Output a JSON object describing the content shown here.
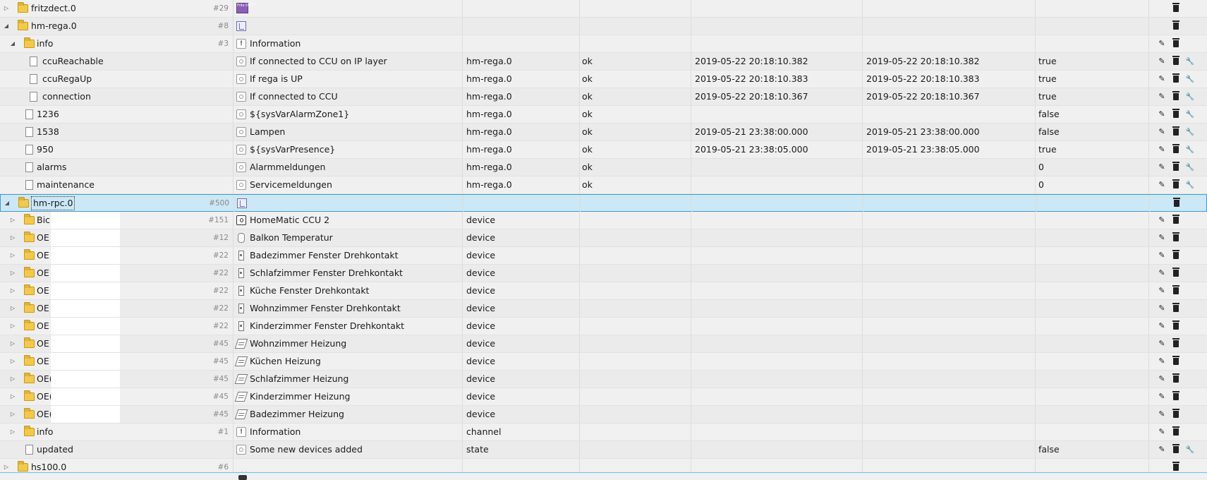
{
  "rows": [
    {
      "level": 0,
      "type": "folder",
      "expander": "collapsed",
      "id": "fritzdect.0",
      "count": "#29",
      "icon": "fritz",
      "icon_text": "Fritz DECT",
      "name": "",
      "role": "",
      "quality": "",
      "ts": "",
      "lc": "",
      "value": "",
      "actions": [
        "delete"
      ]
    },
    {
      "level": 0,
      "type": "folder",
      "expander": "expanded",
      "id": "hm-rega.0",
      "count": "#8",
      "icon": "rega",
      "name": "",
      "role": "",
      "quality": "",
      "ts": "",
      "lc": "",
      "value": "",
      "actions": [
        "delete"
      ]
    },
    {
      "level": 1,
      "type": "folder",
      "expander": "expanded",
      "id": "info",
      "count": "#3",
      "icon": "info",
      "name": "Information",
      "role": "",
      "quality": "",
      "ts": "",
      "lc": "",
      "value": "",
      "actions": [
        "edit",
        "delete"
      ]
    },
    {
      "level": 2,
      "type": "file",
      "expander": "",
      "id": "ccuReachable",
      "count": "",
      "icon": "state",
      "name": "If connected to CCU on IP layer",
      "role": "hm-rega.0",
      "quality": "ok",
      "ts": "2019-05-22 20:18:10.382",
      "lc": "2019-05-22 20:18:10.382",
      "value": "true",
      "actions": [
        "edit",
        "delete",
        "config"
      ]
    },
    {
      "level": 2,
      "type": "file",
      "expander": "",
      "id": "ccuRegaUp",
      "count": "",
      "icon": "state",
      "name": "If rega is UP",
      "role": "hm-rega.0",
      "quality": "ok",
      "ts": "2019-05-22 20:18:10.383",
      "lc": "2019-05-22 20:18:10.383",
      "value": "true",
      "actions": [
        "edit",
        "delete",
        "config"
      ]
    },
    {
      "level": 2,
      "type": "file",
      "expander": "",
      "id": "connection",
      "count": "",
      "icon": "state",
      "name": "If connected to CCU",
      "role": "hm-rega.0",
      "quality": "ok",
      "ts": "2019-05-22 20:18:10.367",
      "lc": "2019-05-22 20:18:10.367",
      "value": "true",
      "actions": [
        "edit",
        "delete",
        "config"
      ]
    },
    {
      "level": 1,
      "type": "file",
      "expander": "",
      "id": "1236",
      "count": "",
      "icon": "state",
      "name": "${sysVarAlarmZone1}",
      "role": "hm-rega.0",
      "quality": "ok",
      "ts": "",
      "lc": "",
      "value": "false",
      "actions": [
        "edit",
        "delete",
        "config"
      ]
    },
    {
      "level": 1,
      "type": "file",
      "expander": "",
      "id": "1538",
      "count": "",
      "icon": "state",
      "name": "Lampen",
      "role": "hm-rega.0",
      "quality": "ok",
      "ts": "2019-05-21 23:38:00.000",
      "lc": "2019-05-21 23:38:00.000",
      "value": "false",
      "actions": [
        "edit",
        "delete",
        "config"
      ]
    },
    {
      "level": 1,
      "type": "file",
      "expander": "",
      "id": "950",
      "count": "",
      "icon": "state",
      "name": "${sysVarPresence}",
      "role": "hm-rega.0",
      "quality": "ok",
      "ts": "2019-05-21 23:38:05.000",
      "lc": "2019-05-21 23:38:05.000",
      "value": "true",
      "actions": [
        "edit",
        "delete",
        "config"
      ]
    },
    {
      "level": 1,
      "type": "file",
      "expander": "",
      "id": "alarms",
      "count": "",
      "icon": "state",
      "name": "Alarmmeldungen",
      "role": "hm-rega.0",
      "quality": "ok",
      "ts": "",
      "lc": "",
      "value": "0",
      "actions": [
        "edit",
        "delete",
        "config"
      ]
    },
    {
      "level": 1,
      "type": "file",
      "expander": "",
      "id": "maintenance",
      "count": "",
      "icon": "state",
      "name": "Servicemeldungen",
      "role": "hm-rega.0",
      "quality": "ok",
      "ts": "",
      "lc": "",
      "value": "0",
      "actions": [
        "edit",
        "delete",
        "config"
      ]
    },
    {
      "level": 0,
      "type": "folder",
      "expander": "expanded",
      "id": "hm-rpc.0",
      "count": "#500",
      "icon": "rega",
      "name": "",
      "role": "",
      "quality": "",
      "ts": "",
      "lc": "",
      "value": "",
      "actions": [
        "delete"
      ],
      "selected": true
    },
    {
      "level": 1,
      "type": "folder",
      "expander": "collapsed",
      "id": "Bic",
      "count": "#151",
      "icon": "device",
      "name": "HomeMatic CCU 2",
      "role": "device",
      "quality": "",
      "ts": "",
      "lc": "",
      "value": "",
      "actions": [
        "edit",
        "delete"
      ],
      "masked": true
    },
    {
      "level": 1,
      "type": "folder",
      "expander": "collapsed",
      "id": "OE",
      "count": "#12",
      "icon": "sensor",
      "name": "Balkon Temperatur",
      "role": "device",
      "quality": "",
      "ts": "",
      "lc": "",
      "value": "",
      "actions": [
        "edit",
        "delete"
      ],
      "masked": true
    },
    {
      "level": 1,
      "type": "folder",
      "expander": "collapsed",
      "id": "OE",
      "count": "#22",
      "icon": "contact",
      "name": "Badezimmer Fenster Drehkontakt",
      "role": "device",
      "quality": "",
      "ts": "",
      "lc": "",
      "value": "",
      "actions": [
        "edit",
        "delete"
      ],
      "masked": true
    },
    {
      "level": 1,
      "type": "folder",
      "expander": "collapsed",
      "id": "OE",
      "count": "#22",
      "icon": "contact",
      "name": "Schlafzimmer Fenster Drehkontakt",
      "role": "device",
      "quality": "",
      "ts": "",
      "lc": "",
      "value": "",
      "actions": [
        "edit",
        "delete"
      ],
      "masked": true
    },
    {
      "level": 1,
      "type": "folder",
      "expander": "collapsed",
      "id": "OE",
      "count": "#22",
      "icon": "contact",
      "name": "Küche Fenster Drehkontakt",
      "role": "device",
      "quality": "",
      "ts": "",
      "lc": "",
      "value": "",
      "actions": [
        "edit",
        "delete"
      ],
      "masked": true
    },
    {
      "level": 1,
      "type": "folder",
      "expander": "collapsed",
      "id": "OE",
      "count": "#22",
      "icon": "contact",
      "name": "Wohnzimmer Fenster Drehkontakt",
      "role": "device",
      "quality": "",
      "ts": "",
      "lc": "",
      "value": "",
      "actions": [
        "edit",
        "delete"
      ],
      "masked": true
    },
    {
      "level": 1,
      "type": "folder",
      "expander": "collapsed",
      "id": "OE",
      "count": "#22",
      "icon": "contact",
      "name": "Kinderzimmer Fenster Drehkontakt",
      "role": "device",
      "quality": "",
      "ts": "",
      "lc": "",
      "value": "",
      "actions": [
        "edit",
        "delete"
      ],
      "masked": true
    },
    {
      "level": 1,
      "type": "folder",
      "expander": "collapsed",
      "id": "OE",
      "count": "#45",
      "icon": "heat",
      "name": "Wohnzimmer Heizung",
      "role": "device",
      "quality": "",
      "ts": "",
      "lc": "",
      "value": "",
      "actions": [
        "edit",
        "delete"
      ],
      "masked": true
    },
    {
      "level": 1,
      "type": "folder",
      "expander": "collapsed",
      "id": "OE",
      "count": "#45",
      "icon": "heat",
      "name": "Küchen Heizung",
      "role": "device",
      "quality": "",
      "ts": "",
      "lc": "",
      "value": "",
      "actions": [
        "edit",
        "delete"
      ],
      "masked": true
    },
    {
      "level": 1,
      "type": "folder",
      "expander": "collapsed",
      "id": "OE(",
      "count": "#45",
      "icon": "heat",
      "name": "Schlafzimmer Heizung",
      "role": "device",
      "quality": "",
      "ts": "",
      "lc": "",
      "value": "",
      "actions": [
        "edit",
        "delete"
      ],
      "masked": true
    },
    {
      "level": 1,
      "type": "folder",
      "expander": "collapsed",
      "id": "OE(",
      "count": "#45",
      "icon": "heat",
      "name": "Kinderzimmer Heizung",
      "role": "device",
      "quality": "",
      "ts": "",
      "lc": "",
      "value": "",
      "actions": [
        "edit",
        "delete"
      ],
      "masked": true
    },
    {
      "level": 1,
      "type": "folder",
      "expander": "collapsed",
      "id": "OE(",
      "count": "#45",
      "icon": "heat",
      "name": "Badezimmer Heizung",
      "role": "device",
      "quality": "",
      "ts": "",
      "lc": "",
      "value": "",
      "actions": [
        "edit",
        "delete"
      ],
      "masked": true
    },
    {
      "level": 1,
      "type": "folder",
      "expander": "collapsed",
      "id": "info",
      "count": "#1",
      "icon": "info",
      "name": "Information",
      "role": "channel",
      "quality": "",
      "ts": "",
      "lc": "",
      "value": "",
      "actions": [
        "edit",
        "delete"
      ]
    },
    {
      "level": 1,
      "type": "file",
      "expander": "",
      "id": "updated",
      "count": "",
      "icon": "state",
      "name": "Some new devices added",
      "role": "state",
      "quality": "",
      "ts": "",
      "lc": "",
      "value": "false",
      "actions": [
        "edit",
        "delete",
        "config"
      ]
    },
    {
      "level": 0,
      "type": "folder",
      "expander": "collapsed",
      "id": "hs100.0",
      "count": "#6",
      "icon": "tplink",
      "name": "",
      "role": "",
      "quality": "",
      "ts": "",
      "lc": "",
      "value": "",
      "actions": [
        "delete"
      ]
    }
  ],
  "action_icons": {
    "edit": "pencil-icon",
    "delete": "trash-icon",
    "config": "wrench-icon"
  }
}
